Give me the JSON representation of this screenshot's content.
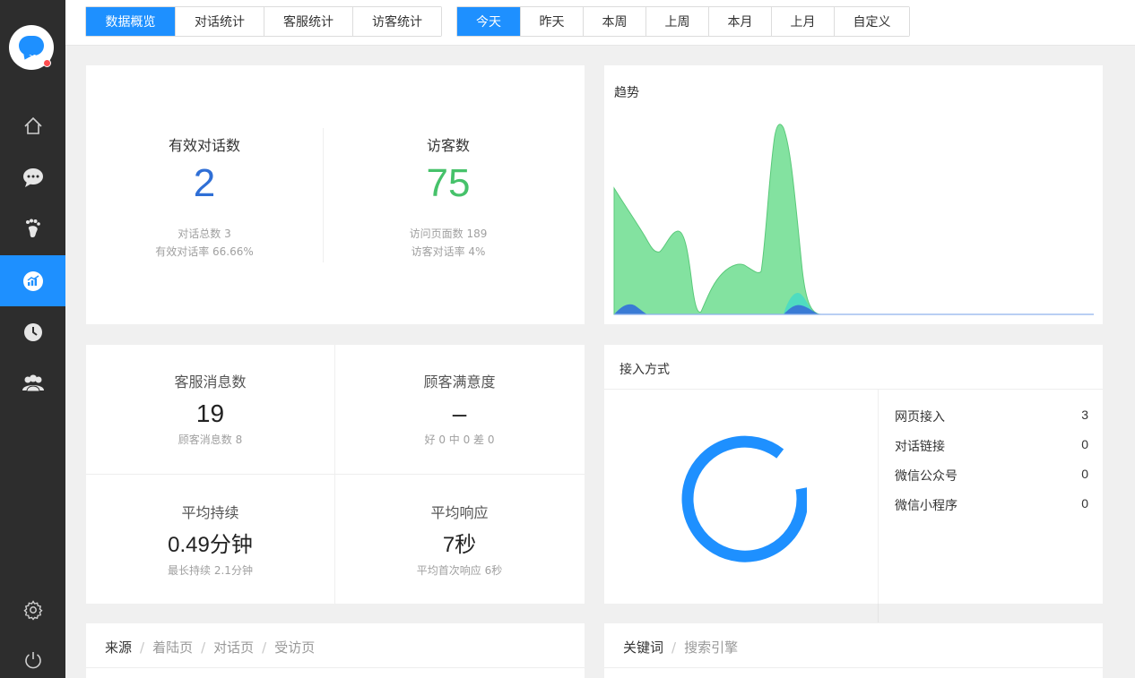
{
  "sidebar": {
    "logo": "chat-bubble-logo",
    "items": [
      {
        "icon": "home-icon"
      },
      {
        "icon": "chat-icon"
      },
      {
        "icon": "footprint-icon"
      },
      {
        "icon": "chart-icon",
        "active": true
      },
      {
        "icon": "clock-icon"
      },
      {
        "icon": "users-icon"
      }
    ],
    "bottom": [
      {
        "icon": "gear-icon"
      },
      {
        "icon": "power-icon"
      }
    ]
  },
  "topbar": {
    "view_tabs": [
      "数据概览",
      "对话统计",
      "客服统计",
      "访客统计"
    ],
    "active_view": 0,
    "date_tabs": [
      "今天",
      "昨天",
      "本周",
      "上周",
      "本月",
      "上月",
      "自定义"
    ],
    "active_date": 0
  },
  "overview": {
    "valid_conversations": {
      "title": "有效对话数",
      "value": "2",
      "sub1": "对话总数 3",
      "sub2": "有效对话率 66.66%"
    },
    "visitors": {
      "title": "访客数",
      "value": "75",
      "sub1": "访问页面数 189",
      "sub2": "访客对话率 4%"
    }
  },
  "trend": {
    "title": "趋势"
  },
  "metrics": {
    "agent_messages": {
      "title": "客服消息数",
      "value": "19",
      "sub": "顾客消息数 8"
    },
    "satisfaction": {
      "title": "顾客满意度",
      "value": "–",
      "sub": "好 0 中 0 差 0"
    },
    "avg_duration": {
      "title": "平均持续",
      "value": "0.49分钟",
      "sub": "最长持续 2.1分钟"
    },
    "avg_response": {
      "title": "平均响应",
      "value": "7秒",
      "sub": "平均首次响应 6秒"
    }
  },
  "access": {
    "title": "接入方式",
    "items": [
      {
        "label": "网页接入",
        "count": "3"
      },
      {
        "label": "对话链接",
        "count": "0"
      },
      {
        "label": "微信公众号",
        "count": "0"
      },
      {
        "label": "微信小程序",
        "count": "0"
      }
    ]
  },
  "sources": {
    "tabs": [
      "来源",
      "着陆页",
      "对话页",
      "受访页"
    ]
  },
  "keywords": {
    "tabs": [
      "关键词",
      "搜索引擎"
    ]
  },
  "colors": {
    "accent": "#1e90ff",
    "blue_value": "#2f6fd6",
    "green_value": "#46c26a",
    "trend_green": "#7ee09a",
    "trend_blue": "#3a7bd5"
  }
}
